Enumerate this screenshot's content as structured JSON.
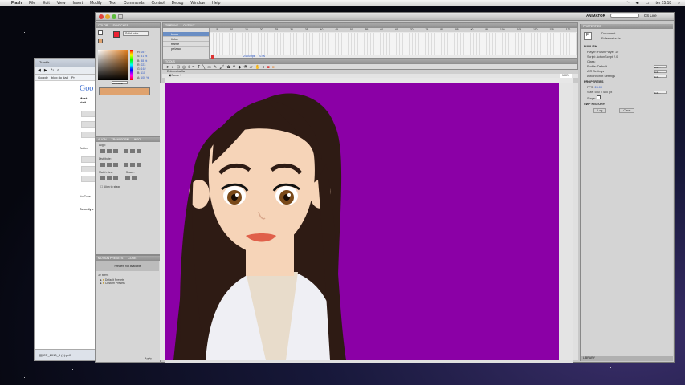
{
  "menubar": {
    "app_name": "Flash",
    "items": [
      "File",
      "Edit",
      "View",
      "Insert",
      "Modify",
      "Text",
      "Commands",
      "Control",
      "Debug",
      "Window",
      "Help"
    ],
    "workspace": "ANIMATOR",
    "search_placeholder": "",
    "live": "CS Live",
    "clock": "ter 15:18"
  },
  "browser": {
    "tab": "Tumblr",
    "bookmarks": [
      "Google",
      "blog do dad",
      "Pri"
    ],
    "logo": "Goo",
    "most_visited": "Most visit",
    "side_labels": [
      "Twitter",
      "YouTube"
    ],
    "recently": "Recently c",
    "download": "CP_2010_3 (1).pdf"
  },
  "color_panel": {
    "tabs": [
      "COLOR",
      "SWATCHES"
    ],
    "fill_type": "Solid color",
    "h": "25 °",
    "s": "51 %",
    "b": "88 %",
    "r": "223",
    "g": "162",
    "b_val": "110",
    "alpha": "100 %",
    "hex": "#DFA26E",
    "fill_hex": "#dfa26e"
  },
  "align_panel": {
    "tabs": [
      "ALIGN",
      "TRANSFORM",
      "INFO"
    ],
    "align": "Align:",
    "distribute": "Distribute:",
    "match": "Match size:",
    "space": "Space:",
    "stage": "Align to stage"
  },
  "presets": {
    "tabs": [
      "MOTION PRESETS",
      "CODE"
    ],
    "preview": "Preview not available",
    "count": "32 items",
    "items": [
      "Default Presets",
      "Custom Presets"
    ],
    "apply": "Apply"
  },
  "timeline": {
    "tab": "TIMELINE",
    "tab2": "OUTPUT",
    "layers": [
      "boca",
      "linha",
      "frame",
      "pelaao"
    ],
    "ticks": [
      "5",
      "10",
      "15",
      "20",
      "25",
      "30",
      "35",
      "40",
      "45",
      "50",
      "55",
      "60",
      "65",
      "70",
      "75",
      "80",
      "85",
      "90",
      "95",
      "100",
      "105",
      "110",
      "115",
      "120"
    ],
    "fps": "24.00 fps",
    "time": "0.0s"
  },
  "tools_tab": "TOOLS",
  "document": {
    "tab": "Enfermeira.fla",
    "scene": "Scene 1",
    "zoom": "100%"
  },
  "properties": {
    "tabs": [
      "PROPERTIES",
      "LIBRARY"
    ],
    "type": "Document",
    "name": "Enfermeira.fla",
    "publish": "PUBLISH",
    "player": "Player: Flash Player 10",
    "script": "Script: ActionScript 2.0",
    "class": "Class:",
    "profile": "Profile: Default",
    "air": "AIR Settings",
    "as": "ActionScript Settings",
    "props": "PROPERTIES",
    "fps_label": "FPS:",
    "fps": "24.00",
    "size": "Size: 550 x 400 px",
    "stage_label": "Stage:",
    "history": "SWF HISTORY",
    "log": "Log",
    "clear": "Clear",
    "edit": "Edit...",
    "library_tab": "LIBRARY"
  },
  "colors": {
    "stage": "#8b00a6",
    "skin": "#f6d4b8",
    "hair": "#2e1b14",
    "shirt": "#efeff4"
  }
}
